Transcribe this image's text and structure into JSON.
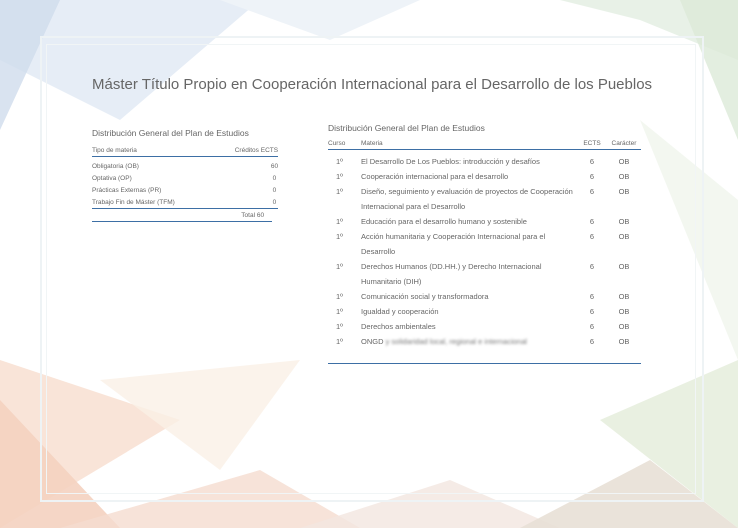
{
  "page_title": "Máster Título Propio en Cooperación Internacional para el Desarrollo de los Pueblos",
  "summary": {
    "heading": "Distribución General del Plan de Estudios",
    "col_tipo": "Tipo de materia",
    "col_creditos": "Créditos ECTS",
    "rows": [
      {
        "tipo": "Obligatoria (OB)",
        "creditos": "60"
      },
      {
        "tipo": "Optativa (OP)",
        "creditos": "0"
      },
      {
        "tipo": "Prácticas Externas (PR)",
        "creditos": "0"
      },
      {
        "tipo": "Trabajo Fin de Máster (TFM)",
        "creditos": "0"
      }
    ],
    "total": "Total 60"
  },
  "detail": {
    "heading": "Distribución General del Plan de Estudios",
    "col_curso": "Curso",
    "col_materia": "Materia",
    "col_ects": "ECTS",
    "col_caracter": "Carácter",
    "rows": [
      {
        "curso": "1º",
        "materia": "El Desarrollo De Los Pueblos: introducción y desafíos",
        "ects": "6",
        "caracter": "OB"
      },
      {
        "curso": "1º",
        "materia": "Cooperación internacional para el desarrollo",
        "ects": "6",
        "caracter": "OB"
      },
      {
        "curso": "1º",
        "materia": "Diseño, seguimiento y evaluación de proyectos de Cooperación Internacional para el Desarrollo",
        "ects": "6",
        "caracter": "OB"
      },
      {
        "curso": "1º",
        "materia": "Educación para el desarrollo humano y sostenible",
        "ects": "6",
        "caracter": "OB"
      },
      {
        "curso": "1º",
        "materia": "Acción humanitaria y Cooperación Internacional para el Desarrollo",
        "ects": "6",
        "caracter": "OB"
      },
      {
        "curso": "1º",
        "materia": "Derechos Humanos (DD.HH.) y Derecho Internacional Humanitario (DIH)",
        "ects": "6",
        "caracter": "OB"
      },
      {
        "curso": "1º",
        "materia": "Comunicación social y transformadora",
        "ects": "6",
        "caracter": "OB"
      },
      {
        "curso": "1º",
        "materia": "Igualdad y cooperación",
        "ects": "6",
        "caracter": "OB"
      },
      {
        "curso": "1º",
        "materia": "Derechos ambientales",
        "ects": "6",
        "caracter": "OB"
      },
      {
        "curso": "1º",
        "materia_visible": "ONGD",
        "materia_blurred": "y solidaridad local, regional e internacional",
        "ects": "6",
        "caracter": "OB"
      }
    ]
  }
}
